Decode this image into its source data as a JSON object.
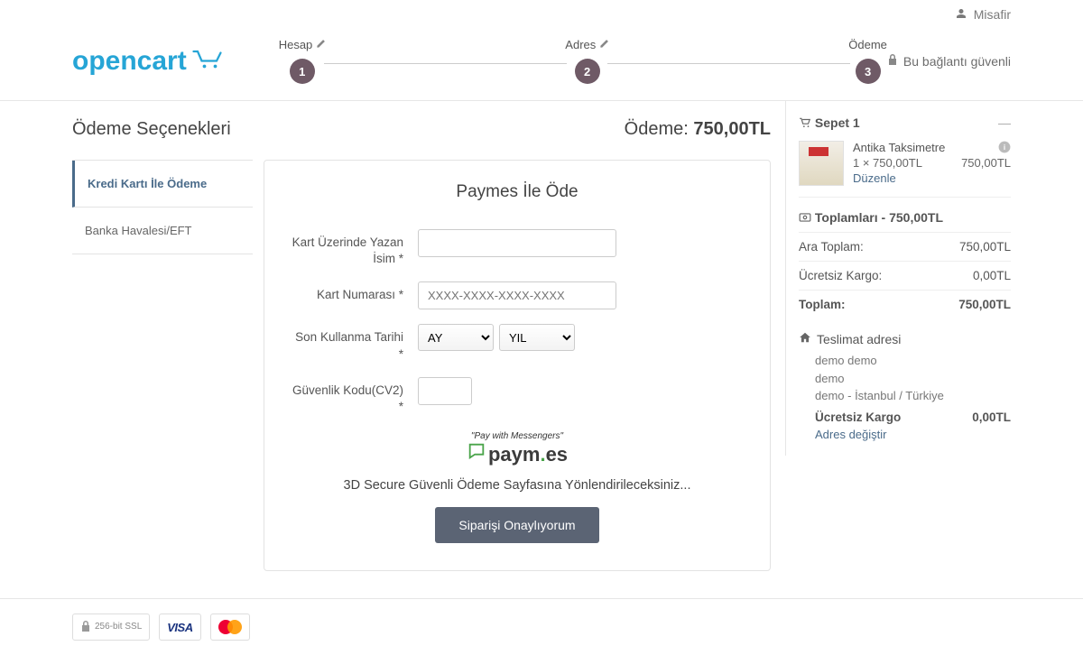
{
  "topbar": {
    "guest": "Misafir"
  },
  "brand": "opencart",
  "secure_text": "Bu bağlantı güvenli",
  "steps": [
    {
      "label": "Hesap",
      "num": "1"
    },
    {
      "label": "Adres",
      "num": "2"
    },
    {
      "label": "Ödeme",
      "num": "3"
    }
  ],
  "page": {
    "title": "Ödeme Seçenekleri",
    "total_label": "Ödeme:",
    "total_value": "750,00TL"
  },
  "tabs": {
    "cc": "Kredi Kartı İle Ödeme",
    "eft": "Banka Havalesi/EFT"
  },
  "form": {
    "title": "Paymes İle Öde",
    "cardholder": "Kart Üzerinde Yazan İsim *",
    "cardnum": "Kart Numarası *",
    "cardnum_ph": "XXXX-XXXX-XXXX-XXXX",
    "expiry": "Son Kullanma Tarihi *",
    "month_ph": "AY",
    "year_ph": "YIL",
    "cvv": "Güvenlik Kodu(CV2) *",
    "brand_tag": "\"Pay with Messengers\"",
    "brand_name": "paym.es",
    "redirect": "3D Secure Güvenli Ödeme Sayfasına Yönlendirileceksiniz...",
    "confirm": "Siparişi Onaylıyorum"
  },
  "cart": {
    "head": "Sepet 1",
    "item": {
      "name": "Antika Taksimetre",
      "qty_price": "1 × 750,00TL",
      "line_total": "750,00TL",
      "edit": "Düzenle"
    },
    "totals_head": "Toplamları - 750,00TL",
    "subtotal_label": "Ara Toplam:",
    "subtotal_val": "750,00TL",
    "ship_label": "Ücretsiz Kargo:",
    "ship_val": "0,00TL",
    "total_label": "Toplam:",
    "total_val": "750,00TL"
  },
  "address": {
    "head": "Teslimat adresi",
    "line1": "demo demo",
    "line2": "demo",
    "line3": "demo - İstanbul / Türkiye",
    "ship_name": "Ücretsiz Kargo",
    "ship_val": "0,00TL",
    "change": "Adres değiştir"
  },
  "footer": {
    "ssl": "256-bit SSL",
    "visa": "VISA"
  }
}
